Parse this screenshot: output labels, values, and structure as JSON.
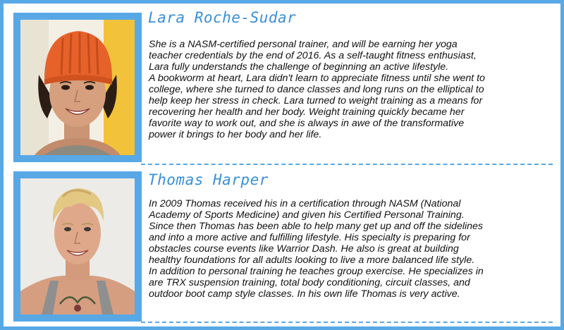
{
  "colors": {
    "accent_blue": "#58a8e6",
    "name_blue": "#3a8fd6",
    "text": "#111111"
  },
  "profiles": [
    {
      "name": "Lara Roche-Sudar",
      "photo": "portrait of a smiling woman wearing an orange knit beanie",
      "bio_lines": [
        "She is a NASM-certified personal trainer, and will be earning her yoga",
        "teacher credentials by the end of 2016. As a self-taught fitness enthusiast,",
        "Lara fully understands the challenge of beginning an active lifestyle.",
        "A bookworm at heart, Lara didn't learn to appreciate fitness until she went to",
        "college, where she turned to dance classes and long runs on the elliptical to",
        "help keep her stress in check. Lara turned to weight training as a means for",
        "recovering her health and her body. Weight training quickly became her",
        "favorite way to work out, and she is always in awe of the transformative",
        "power it brings to her body and her life."
      ]
    },
    {
      "name": "Thomas Harper",
      "photo": "portrait of a smiling blond man in a gray tank top with a chest tattoo",
      "bio_lines": [
        "In 2009 Thomas received his in a certification through NASM (National",
        "Academy of Sports Medicine) and given his Certified Personal Training.",
        "Since then Thomas has been able to help many get up and off the sidelines",
        "and into a more active and fulfilling lifestyle. His specialty is preparing for",
        "obstacles course events like Warrior Dash. He also is great at building",
        "healthy foundations for all adults looking to live a more balanced life style.",
        "In addition to personal training he teaches group exercise. He specializes in",
        "are TRX suspension training, total body conditioning, circuit classes, and",
        "outdoor boot camp style classes. In his own life Thomas is very active."
      ]
    }
  ]
}
